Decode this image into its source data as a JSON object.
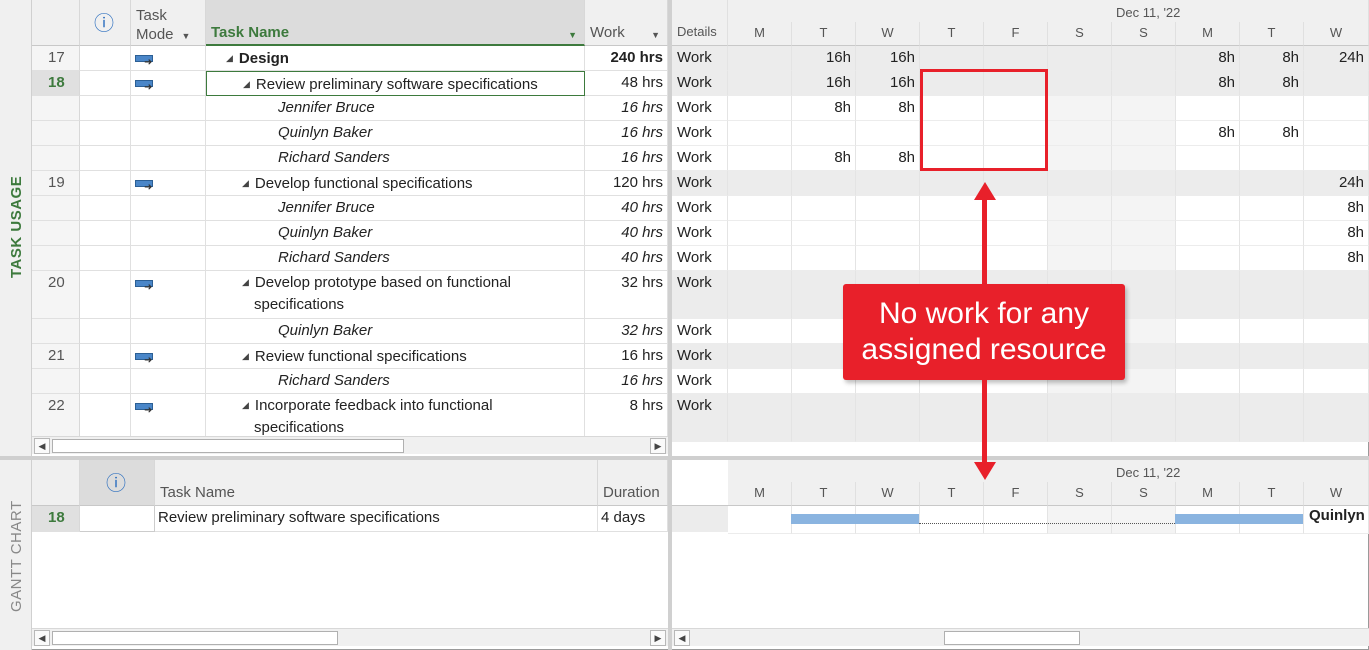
{
  "view_labels": {
    "task_usage": "TASK USAGE",
    "gantt_chart": "GANTT CHART"
  },
  "usage_table": {
    "headers": {
      "info": "ⓘ",
      "task_mode_1": "Task",
      "task_mode_2": "Mode",
      "task_name": "Task Name",
      "work": "Work",
      "details": "Details"
    },
    "rows": [
      {
        "id": "17",
        "name": "Design",
        "work": "240 hrs",
        "details": "Work",
        "level": "summary"
      },
      {
        "id": "18",
        "name": "Review preliminary software specifications",
        "work": "48 hrs",
        "details": "Work",
        "level": "task"
      },
      {
        "id": "",
        "name": "Jennifer Bruce",
        "work": "16 hrs",
        "details": "Work",
        "level": "assignment"
      },
      {
        "id": "",
        "name": "Quinlyn Baker",
        "work": "16 hrs",
        "details": "Work",
        "level": "assignment"
      },
      {
        "id": "",
        "name": "Richard Sanders",
        "work": "16 hrs",
        "details": "Work",
        "level": "assignment"
      },
      {
        "id": "19",
        "name": "Develop functional specifications",
        "work": "120 hrs",
        "details": "Work",
        "level": "task"
      },
      {
        "id": "",
        "name": "Jennifer Bruce",
        "work": "40 hrs",
        "details": "Work",
        "level": "assignment"
      },
      {
        "id": "",
        "name": "Quinlyn Baker",
        "work": "40 hrs",
        "details": "Work",
        "level": "assignment"
      },
      {
        "id": "",
        "name": "Richard Sanders",
        "work": "40 hrs",
        "details": "Work",
        "level": "assignment"
      },
      {
        "id": "20",
        "name": "Develop prototype based on functional",
        "name2": "specifications",
        "work": "32 hrs",
        "details": "Work",
        "level": "task"
      },
      {
        "id": "",
        "name": "Quinlyn Baker",
        "work": "32 hrs",
        "details": "Work",
        "level": "assignment"
      },
      {
        "id": "21",
        "name": "Review functional specifications",
        "work": "16 hrs",
        "details": "Work",
        "level": "task"
      },
      {
        "id": "",
        "name": "Richard Sanders",
        "work": "16 hrs",
        "details": "Work",
        "level": "assignment"
      },
      {
        "id": "22",
        "name": "Incorporate feedback into functional",
        "name2": "specifications",
        "work": "8 hrs",
        "details": "Work",
        "level": "task"
      }
    ]
  },
  "timescale": {
    "week_label": "Dec 11, '22",
    "days": [
      "M",
      "T",
      "W",
      "T",
      "F",
      "S",
      "S",
      "M",
      "T",
      "W"
    ],
    "values": [
      [
        "",
        "16h",
        "16h",
        "",
        "",
        "",
        "",
        "8h",
        "8h",
        "24h"
      ],
      [
        "",
        "16h",
        "16h",
        "",
        "",
        "",
        "",
        "8h",
        "8h",
        ""
      ],
      [
        "",
        "8h",
        "8h",
        "",
        "",
        "",
        "",
        "",
        "",
        ""
      ],
      [
        "",
        "",
        "",
        "",
        "",
        "",
        "",
        "8h",
        "8h",
        ""
      ],
      [
        "",
        "8h",
        "8h",
        "",
        "",
        "",
        "",
        "",
        "",
        ""
      ],
      [
        "",
        "",
        "",
        "",
        "",
        "",
        "",
        "",
        "",
        "24h"
      ],
      [
        "",
        "",
        "",
        "",
        "",
        "",
        "",
        "",
        "",
        "8h"
      ],
      [
        "",
        "",
        "",
        "",
        "",
        "",
        "",
        "",
        "",
        "8h"
      ],
      [
        "",
        "",
        "",
        "",
        "",
        "",
        "",
        "",
        "",
        "8h"
      ],
      [
        "",
        "",
        "",
        "",
        "",
        "",
        "",
        "",
        "",
        ""
      ],
      [
        "",
        "",
        "",
        "",
        "",
        "",
        "",
        "",
        "",
        ""
      ],
      [
        "",
        "",
        "",
        "",
        "",
        "",
        "",
        "",
        "",
        ""
      ],
      [
        "",
        "",
        "",
        "",
        "",
        "",
        "",
        "",
        "",
        ""
      ],
      [
        "",
        "",
        "",
        "",
        "",
        "",
        "",
        "",
        "",
        ""
      ]
    ]
  },
  "gantt_table": {
    "headers": {
      "info": "ⓘ",
      "task_name": "Task Name",
      "duration": "Duration"
    },
    "row": {
      "id": "18",
      "name": "Review preliminary software specifications",
      "duration": "4 days"
    },
    "bar_label": "Quinlyn"
  },
  "callout": {
    "line1": "No work for any",
    "line2": "assigned resource"
  },
  "colors": {
    "accent_green": "#3d7a3d",
    "callout_red": "#e8202a",
    "gantt_bar": "#8ab4e0"
  }
}
